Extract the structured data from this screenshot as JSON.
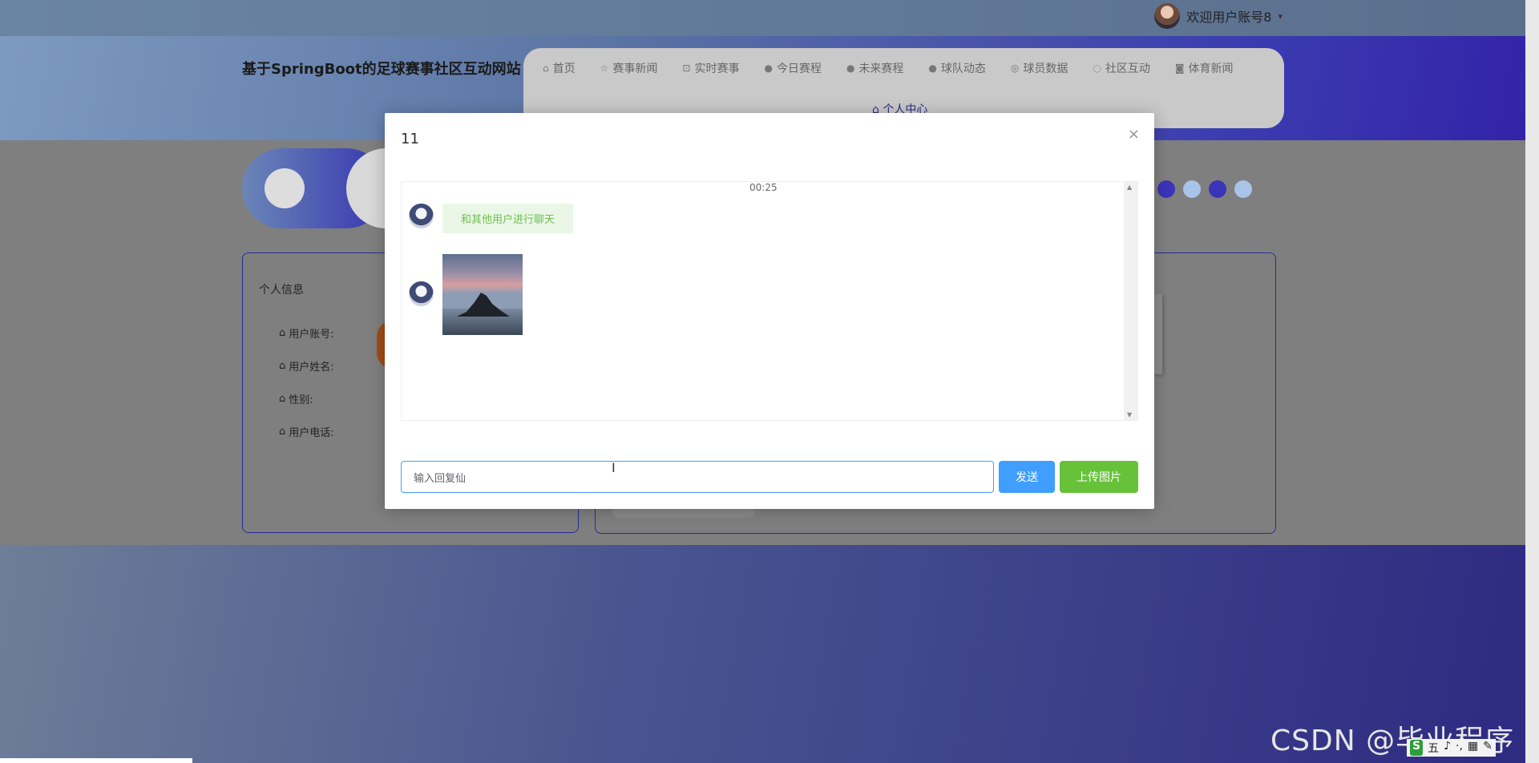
{
  "topbar": {
    "welcome": "欢迎用户账号8",
    "caret": "▾"
  },
  "header": {
    "site_title": "基于SpringBoot的足球赛事社区互动网站",
    "nav": [
      {
        "icon": "⌂",
        "icon_name": "home-icon",
        "label": "首页"
      },
      {
        "icon": "☆",
        "icon_name": "star-icon",
        "label": "赛事新闻"
      },
      {
        "icon": "⊡",
        "icon_name": "lock-icon",
        "label": "实时赛事"
      },
      {
        "icon": "●",
        "icon_name": "info-icon",
        "label": "今日赛程"
      },
      {
        "icon": "●",
        "icon_name": "question-icon",
        "label": "未来赛程"
      },
      {
        "icon": "●",
        "icon_name": "info-circle-icon",
        "label": "球队动态"
      },
      {
        "icon": "◎",
        "icon_name": "settings-icon",
        "label": "球员数据"
      },
      {
        "icon": "◌",
        "icon_name": "community-icon",
        "label": "社区互动"
      },
      {
        "icon": "◙",
        "icon_name": "camera-icon",
        "label": "体育新闻"
      }
    ],
    "nav_sub": {
      "icon": "⌂",
      "label": "个人中心"
    }
  },
  "profile": {
    "title": "个人信息",
    "rows": [
      {
        "icon": "⌂",
        "label": "用户账号:"
      },
      {
        "icon": "⌂",
        "label": "用户姓名:"
      },
      {
        "icon": "⌂",
        "label": "性别:"
      },
      {
        "icon": "⌂",
        "label": "用户电话:"
      }
    ]
  },
  "carousel_dots": {
    "colors": [
      "#3b34b8",
      "#a9c4e8",
      "#3b34b8",
      "#a9c4e8"
    ]
  },
  "modal": {
    "title": "11",
    "close_icon": "×",
    "chat": {
      "time": "00:25",
      "messages": [
        {
          "type": "text",
          "text": "和其他用户进行聊天"
        },
        {
          "type": "image",
          "alt": "sea-rock-sunset-photo"
        }
      ]
    },
    "input_value": "输入回复仙",
    "send_label": "发送",
    "upload_label": "上传图片"
  },
  "watermark": "CSDN @毕业程序员",
  "ime": {
    "logo": "S",
    "items": [
      "五",
      "♪",
      "·,",
      "▦",
      "✎"
    ]
  },
  "colors": {
    "primary": "#409eff",
    "success": "#67c23a",
    "bubble_bg": "#eaf7e6",
    "bubble_text": "#6cc050"
  }
}
